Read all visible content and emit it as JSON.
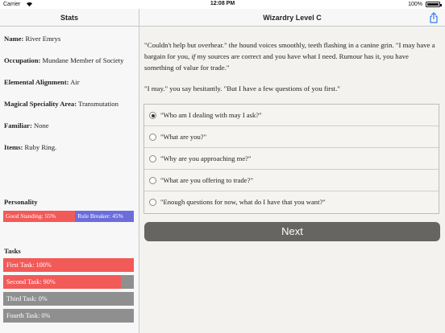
{
  "status_bar": {
    "carrier": "Carrier",
    "time": "12:08 PM",
    "battery": "100%"
  },
  "colors": {
    "accent": "#f25a58",
    "secondary": "#6b6ddc",
    "empty": "#8f8f8f",
    "button": "#666562",
    "icon_blue": "#2f7bf5"
  },
  "left_panel": {
    "title": "Stats",
    "fields": [
      {
        "label": "Name:",
        "value": "River Emrys"
      },
      {
        "label": "Occupation:",
        "value": "Mundane Member of Society"
      },
      {
        "label": "Elemental Alignment:",
        "value": "Air"
      },
      {
        "label": "Magical Speciality Area:",
        "value": "Transmutation"
      },
      {
        "label": "Familiar:",
        "value": "None"
      },
      {
        "label": "Items:",
        "value": "Ruby Ring."
      }
    ],
    "personality": {
      "title": "Personality",
      "good_label": "Good Standing: 55%",
      "good_fraction": 0.55,
      "rule_label": "Rule Breaker: 45%"
    },
    "tasks": {
      "title": "Tasks",
      "items": [
        {
          "label": "First Task: 100%",
          "fraction": 1.0
        },
        {
          "label": "Second Task: 90%",
          "fraction": 0.9
        },
        {
          "label": "Third Task: 0%",
          "fraction": 0.0
        },
        {
          "label": "Fourth Task: 0%",
          "fraction": 0.0
        }
      ]
    }
  },
  "right_panel": {
    "title": "Wizardry Level C",
    "share_icon": "share-icon",
    "story": {
      "para1_start": "\"Couldn't help but overhear.\" the hound voices smoothly, teeth flashing in a canine grin. \"I may have a bargain for you, ",
      "para1_italic": "if",
      "para1_end": " my sources are correct and you have what I need. Rumour has it, you have something of value for trade.\"",
      "para2": "\"I may.\" you say hesitantly. \"But I have a few questions of you first.\""
    },
    "choices": [
      {
        "text": "\"Who am I dealing with may I ask?\"",
        "selected": true
      },
      {
        "text": "\"What are you?\"",
        "selected": false
      },
      {
        "text": "\"Why are you approaching me?\"",
        "selected": false
      },
      {
        "text": "\"What are you offering to trade?\"",
        "selected": false
      },
      {
        "text": "\"Enough questions for now, what do I have that you want?\"",
        "selected": false
      }
    ],
    "next_label": "Next"
  }
}
